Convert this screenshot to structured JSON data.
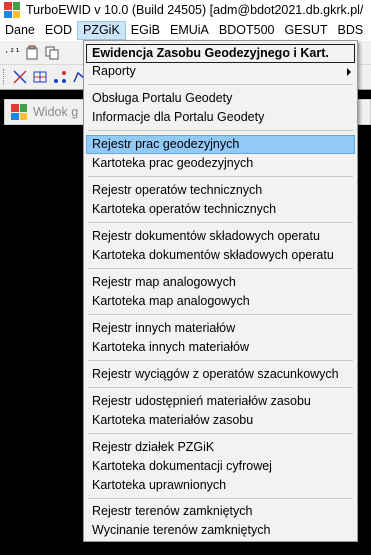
{
  "window": {
    "title": "TurboEWID v 10.0 (Build 24505) [adm@bdot2021.db.gkrk.pl/"
  },
  "menubar": {
    "items": [
      "Dane",
      "EOD",
      "PZGiK",
      "EGiB",
      "EMUiA",
      "BDOT500",
      "GESUT",
      "BDS"
    ],
    "active": "PZGiK"
  },
  "child_window": {
    "title": "Widok g"
  },
  "dropdown": {
    "items": [
      "Ewidencja Zasobu Geodezyjnego i Kart.",
      "Raporty",
      "Obsługa Portalu Geodety",
      "Informacje dla Portalu Geodety",
      "Rejestr prac geodezyjnych",
      "Kartoteka prac geodezyjnych",
      "Rejestr operatów technicznych",
      "Kartoteka operatów technicznych",
      "Rejestr dokumentów składowych operatu",
      "Kartoteka dokumentów składowych operatu",
      "Rejestr map analogowych",
      "Kartoteka map analogowych",
      "Rejestr innych materiałów",
      "Kartoteka innych materiałów",
      "Rejestr wyciągów z operatów szacunkowych",
      "Rejestr udostępnień materiałów zasobu",
      "Kartoteka materiałów zasobu",
      "Rejestr działek PZGiK",
      "Kartoteka dokumentacji cyfrowej",
      "Kartoteka uprawnionych",
      "Rejestr terenów zamkniętych",
      "Wycinanie terenów zamkniętych"
    ],
    "highlighted": "Rejestr prac geodezyjnych"
  },
  "toolbar": {
    "row1_icons": [
      "point-21-icon",
      "paste-icon",
      "copy-icon",
      "measure-icon",
      "object-icon"
    ],
    "row2_icons": [
      "grip-icon",
      "cross-line-icon",
      "table-edit-icon",
      "points-icon",
      "polygon-icon",
      "node-icon"
    ]
  },
  "colors": {
    "menu_highlight": "#91c9f7",
    "menubar_active": "#cce4f7",
    "background": "#000000"
  }
}
